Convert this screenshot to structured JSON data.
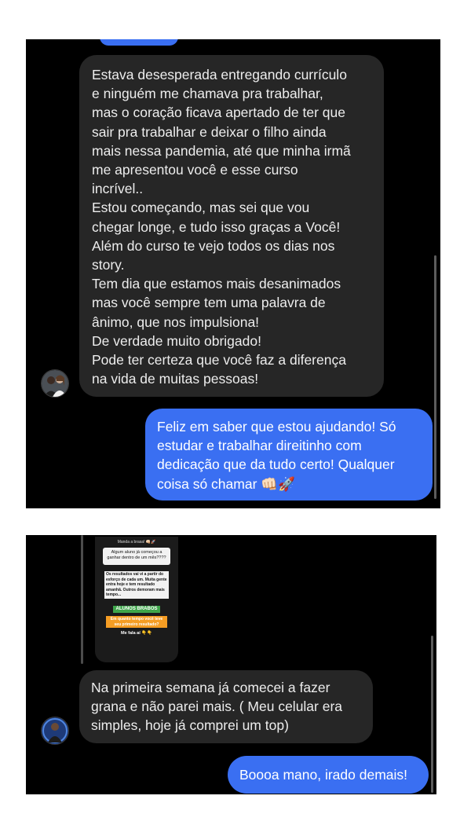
{
  "colors": {
    "panel_background": "#000000",
    "received_bubble": "#262626",
    "sent_bubble": "#3a6ff2",
    "story_green": "#3ea54a",
    "story_orange": "#f59d24"
  },
  "conversation_1": {
    "received_message": "Estava desesperada entregando currículo\ne ninguém me chamava pra trabalhar,\nmas o coração ficava apertado de ter que\nsair pra trabalhar e deixar o filho ainda\nmais nessa pandemia, até que minha irmã\nme apresentou você e esse curso\nincrível..\nEstou começando, mas sei que vou\nchegar longe, e tudo isso graças a Você!\nAlém do curso te vejo todos os dias nos\nstory.\nTem dia que estamos mais desanimados\nmas você sempre tem uma palavra de\nânimo, que nos impulsiona!\nDe verdade muito obrigado!\nPode ter certeza que você faz a diferença\nna vida de muitas pessoas!",
    "sent_message": "Feliz em saber que estou ajudando! Só\nestudar e trabalhar direitinho com\ndedicação que da tudo certo! Qualquer\ncoisa só chamar 👊🏻🚀",
    "avatar_icon": "user-avatar-couple"
  },
  "conversation_2": {
    "story_reply": {
      "header": "Manda a brasa! 👊🏻🚀",
      "question": "Algum aluno já começou a ganhar dentro de um mês????",
      "answer": "Os resultados vai vi a partir do esforço de cada um. Muita gente entra hoje e tem resultado amanhã. Outros demoram mais tempo...",
      "label_green": "ALUNOS BRABOS",
      "label_orange": "Em quanto tempo você teve seu primeiro resultado?",
      "footer": "Me fala aí 👇👇"
    },
    "received_message": "Na primeira semana já comecei a fazer\ngrana e não parei mais. ( Meu celular era\nsimples, hoje já comprei um top)",
    "sent_message": "Boooa mano, irado demais!",
    "avatar_icon": "user-avatar-man"
  }
}
